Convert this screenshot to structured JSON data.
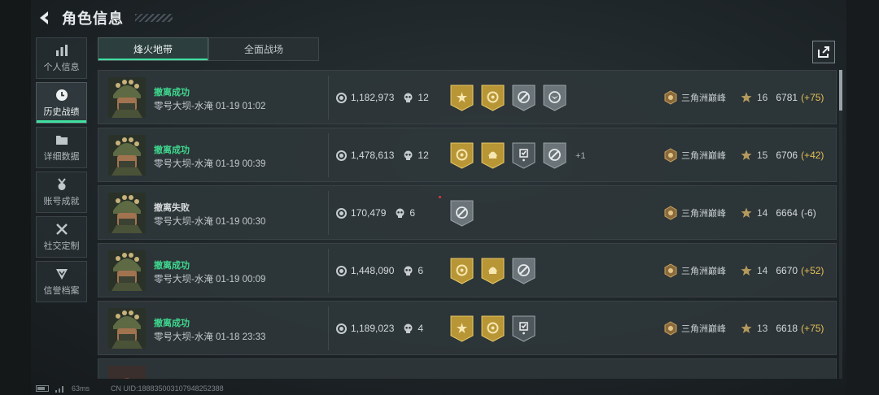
{
  "header": {
    "title": "角色信息"
  },
  "sidebar": {
    "items": [
      {
        "label": "个人信息",
        "icon": "bar-chart-icon",
        "active": false
      },
      {
        "label": "历史战绩",
        "icon": "clock-icon",
        "active": true
      },
      {
        "label": "详细数据",
        "icon": "folder-icon",
        "active": false
      },
      {
        "label": "账号成就",
        "icon": "medal-icon",
        "active": false
      },
      {
        "label": "社交定制",
        "icon": "tools-icon",
        "active": false
      },
      {
        "label": "信誉档案",
        "icon": "shield-icon",
        "active": false
      }
    ]
  },
  "tabs": [
    {
      "label": "烽火地带",
      "active": true
    },
    {
      "label": "全面战场",
      "active": false
    }
  ],
  "share": {
    "icon": "share-icon"
  },
  "records": [
    {
      "result": "撤离成功",
      "status": "success",
      "map": "零号大坝-水淹 01-19 01:02",
      "value": "1,182,973",
      "kills": "12",
      "medals": [
        "gold-sun",
        "gold-circle",
        "silver-compass",
        "silver-eagle"
      ],
      "more": "",
      "rank": "三角洲巅峰",
      "level": "16",
      "score": "6781",
      "delta": "(+75)"
    },
    {
      "result": "撤离成功",
      "status": "success",
      "map": "零号大坝-水淹 01-19 00:39",
      "value": "1,478,613",
      "kills": "12",
      "medals": [
        "gold-circle",
        "gold-helmet",
        "silver-badge",
        "silver-compass"
      ],
      "more": "+1",
      "rank": "三角洲巅峰",
      "level": "15",
      "score": "6706",
      "delta": "(+42)"
    },
    {
      "result": "撤离失败",
      "status": "fail",
      "map": "零号大坝-水淹 01-19 00:30",
      "value": "170,479",
      "kills": "6",
      "medals": [
        "silver-compass"
      ],
      "more": "",
      "rank": "三角洲巅峰",
      "level": "14",
      "score": "6664",
      "delta": "(-6)"
    },
    {
      "result": "撤离成功",
      "status": "success",
      "map": "零号大坝-水淹 01-19 00:09",
      "value": "1,448,090",
      "kills": "6",
      "medals": [
        "gold-circle",
        "gold-helmet",
        "silver-compass"
      ],
      "more": "",
      "rank": "三角洲巅峰",
      "level": "14",
      "score": "6670",
      "delta": "(+52)"
    },
    {
      "result": "撤离成功",
      "status": "success",
      "map": "零号大坝-水淹 01-18 23:33",
      "value": "1,189,023",
      "kills": "4",
      "medals": [
        "gold-sun",
        "gold-circle",
        "silver-badge"
      ],
      "more": "",
      "rank": "三角洲巅峰",
      "level": "13",
      "score": "6618",
      "delta": "(+75)"
    }
  ],
  "footer": {
    "ping": "63ms",
    "uid": "CN UID:188835003107948252388"
  },
  "colors": {
    "success": "#3fd98f",
    "gold": "#e5bf55",
    "accent": "#3fe0a0"
  }
}
